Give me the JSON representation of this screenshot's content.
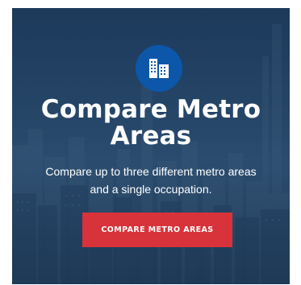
{
  "card": {
    "title_line1": "Compare Metro",
    "title_line2": "Areas",
    "subtitle_line1": "Compare up to three different metro areas",
    "subtitle_line2": "and a single occupation.",
    "button_label": "COMPARE METRO AREAS",
    "icon": "building-icon"
  },
  "colors": {
    "background": "#1c3550",
    "icon_circle": "#0c57a9",
    "button": "#d8333a",
    "text": "#ffffff"
  }
}
